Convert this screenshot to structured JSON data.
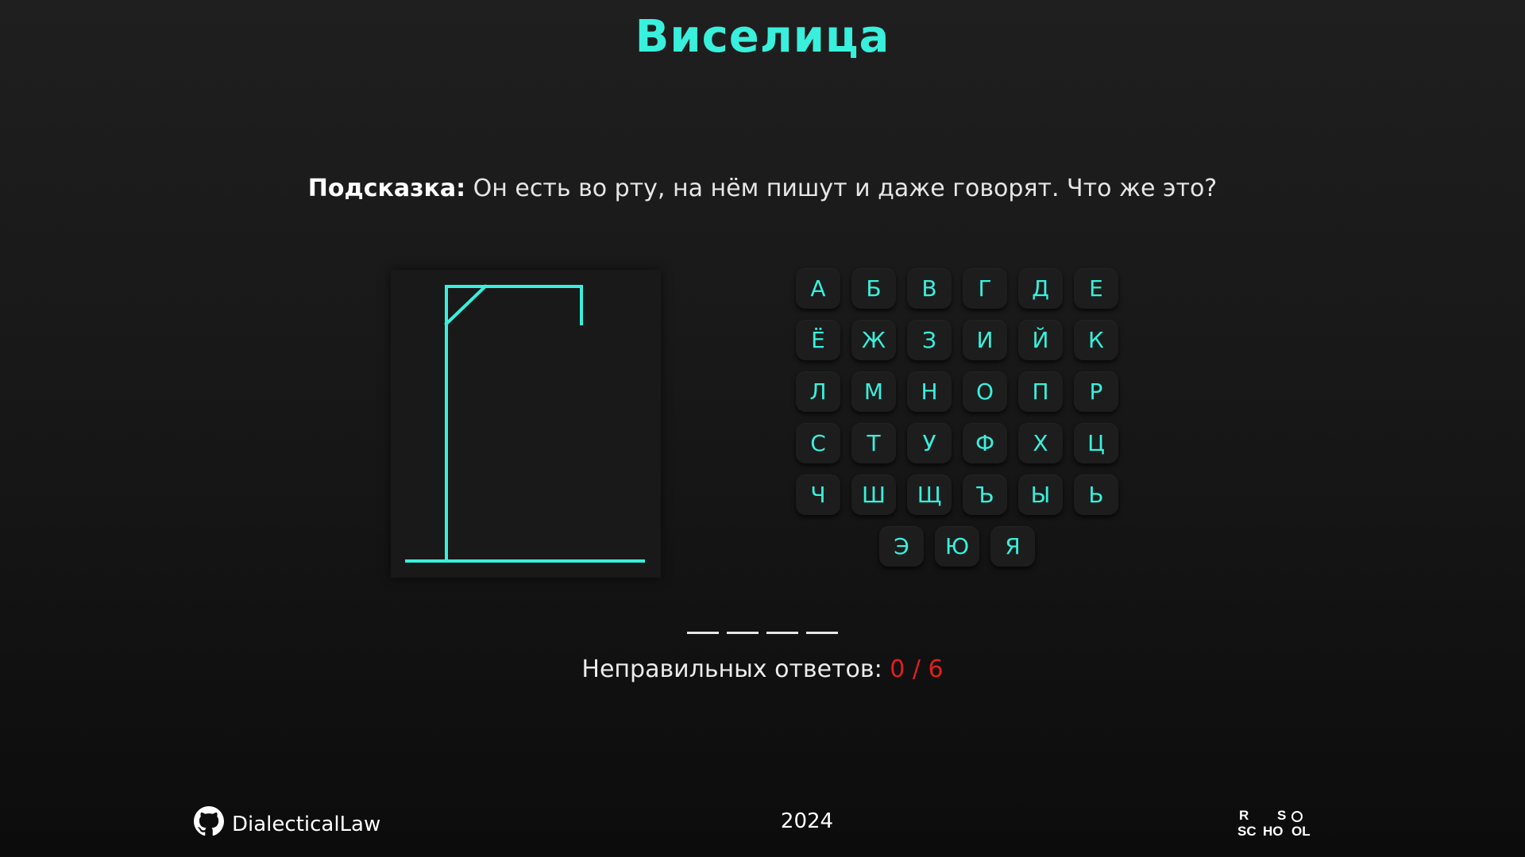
{
  "header": {
    "title": "Виселица"
  },
  "hint": {
    "label": "Подсказка:",
    "text": " Он есть во рту, на нём пишут и даже говорят. Что же это?"
  },
  "keyboard": {
    "rows": [
      [
        "А",
        "Б",
        "В",
        "Г",
        "Д",
        "Е"
      ],
      [
        "Ё",
        "Ж",
        "З",
        "И",
        "Й",
        "К"
      ],
      [
        "Л",
        "М",
        "Н",
        "О",
        "П",
        "Р"
      ],
      [
        "С",
        "Т",
        "У",
        "Ф",
        "Х",
        "Ц"
      ],
      [
        "Ч",
        "Ш",
        "Щ",
        "Ъ",
        "Ы",
        "Ь"
      ],
      [
        "Э",
        "Ю",
        "Я"
      ]
    ]
  },
  "word": {
    "length": 4
  },
  "counter": {
    "label": "Неправильных ответов: ",
    "value": "0 / 6"
  },
  "footer": {
    "github_icon": "github-icon",
    "github_user": "DialecticalLaw",
    "year": "2024",
    "logo_lines": [
      "R",
      "S",
      "SC",
      "HO",
      "OL"
    ]
  },
  "colors": {
    "accent": "#38f0dc",
    "error": "#e01f1f",
    "background": "#1a1a1a"
  }
}
